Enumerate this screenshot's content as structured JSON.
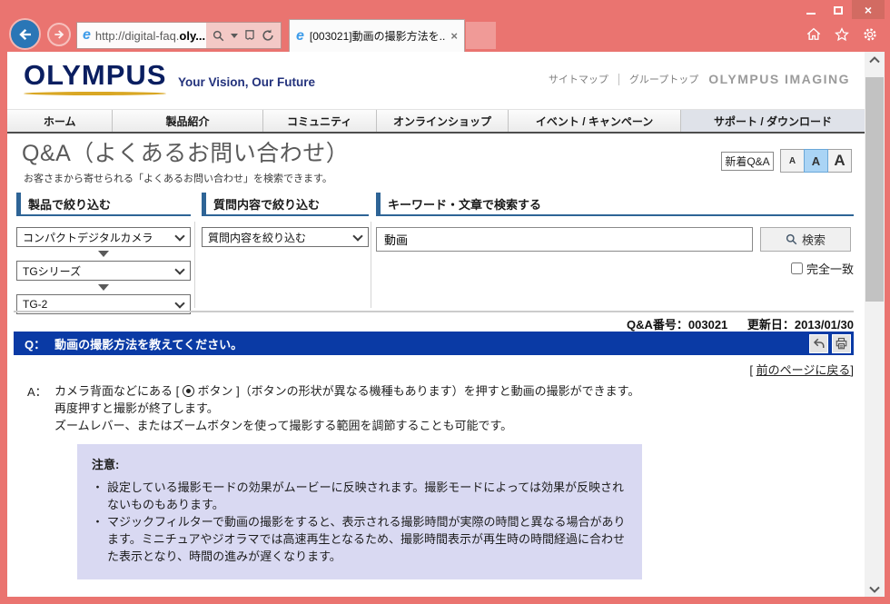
{
  "browser": {
    "url": {
      "scheme_host": "http://digital-faq.",
      "domain_bold": "oly..."
    },
    "tab": {
      "title": "[003021]動画の撮影方法を...",
      "close_glyph": "×"
    },
    "window_controls": {
      "close_glyph": "×"
    }
  },
  "site_header": {
    "logo": "OLYMPUS",
    "tagline": "Your Vision, Our Future",
    "link_sitemap": "サイトマップ",
    "link_grouptop": "グループトップ",
    "brand": "OLYMPUS IMAGING"
  },
  "nav": {
    "items": [
      {
        "label": "ホーム"
      },
      {
        "label": "製品紹介"
      },
      {
        "label": "コミュニティ"
      },
      {
        "label": "オンラインショップ"
      },
      {
        "label": "イベント / キャンペーン"
      },
      {
        "label": "サポート / ダウンロード"
      }
    ]
  },
  "page": {
    "title": "Q&A（よくあるお問い合わせ）",
    "subtitle": "お客さまから寄せられる「よくあるお問い合わせ」を検索できます。",
    "new_qa_button": "新着Q&A",
    "font_size_buttons": [
      "A",
      "A",
      "A"
    ]
  },
  "filters": {
    "product": {
      "heading": "製品で絞り込む",
      "selects": [
        "コンパクトデジタルカメラ",
        "TGシリーズ",
        "TG-2"
      ]
    },
    "question": {
      "heading": "質問内容で絞り込む",
      "select": "質問内容を絞り込む"
    },
    "keyword": {
      "heading": "キーワード・文章で検索する",
      "input_value": "動画",
      "search_button": "検索",
      "exact_match_label": "完全一致"
    }
  },
  "qa": {
    "number_label": "Q&A番号：003021",
    "updated_label": "更新日：2013/01/30",
    "question_prefix": "Q：",
    "question": "動画の撮影方法を教えてください。",
    "back_link_open": "[ ",
    "back_link": "前のページに戻る",
    "back_link_close": "]",
    "answer_prefix": "A：",
    "answer_line1_a": "カメラ背面などにある [ ",
    "answer_line1_b": " ボタン ]（ボタンの形状が異なる機種もあります）を押すと動画の撮影ができます。",
    "answer_line2": "再度押すと撮影が終了します。",
    "answer_line3": "ズームレバー、またはズームボタンを使って撮影する範囲を調節することも可能です。",
    "note": {
      "heading": "注意:",
      "bullet": "・",
      "items": [
        "設定している撮影モードの効果がムービーに反映されます。撮影モードによっては効果が反映されないものもあります。",
        "マジックフィルターで動画の撮影をすると、表示される撮影時間が実際の時間と異なる場合があります。ミニチュアやジオラマでは高速再生となるため、撮影時間表示が再生時の時間経過に合わせた表示となり、時間の進みが遅くなります。"
      ]
    }
  }
}
